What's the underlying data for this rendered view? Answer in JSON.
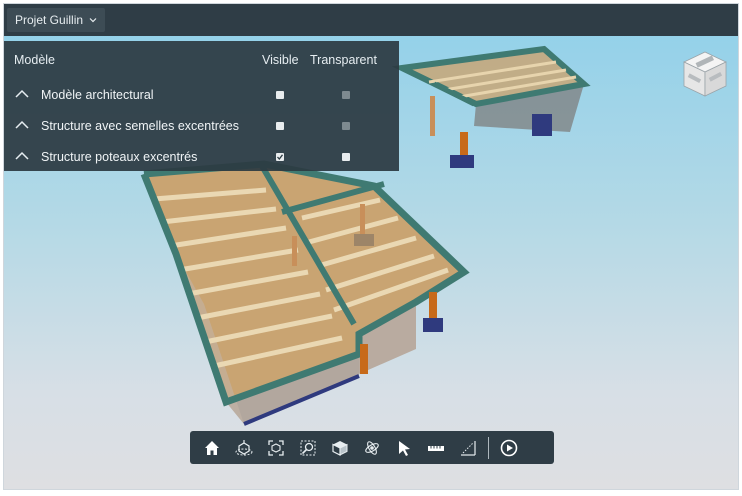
{
  "header": {
    "project_label": "Projet Guillin"
  },
  "models_panel": {
    "col_model": "Modèle",
    "col_visible": "Visible",
    "col_transparent": "Transparent",
    "rows": [
      {
        "label": "Modèle architectural",
        "visible": false,
        "transparent": false,
        "transparent_enabled": false
      },
      {
        "label": "Structure avec semelles excentrées",
        "visible": false,
        "transparent": false,
        "transparent_enabled": false
      },
      {
        "label": "Structure poteaux excentrés",
        "visible": true,
        "transparent": false,
        "transparent_enabled": true
      }
    ]
  },
  "toolbar": {
    "tools": [
      "home-icon",
      "orbit-icon",
      "fit-view-icon",
      "zoom-window-icon",
      "section-box-icon",
      "navigation-icon",
      "select-arrow-icon",
      "measure-icon",
      "area-measure-icon",
      "play-icon"
    ]
  },
  "colors": {
    "topbar": "#2f3d46",
    "panel": "#2c3a42",
    "beam_teal": "#3f7a72",
    "floor_wood": "#c7a06e",
    "column_orange": "#c76a1a",
    "footing_blue": "#2f3a7e"
  }
}
